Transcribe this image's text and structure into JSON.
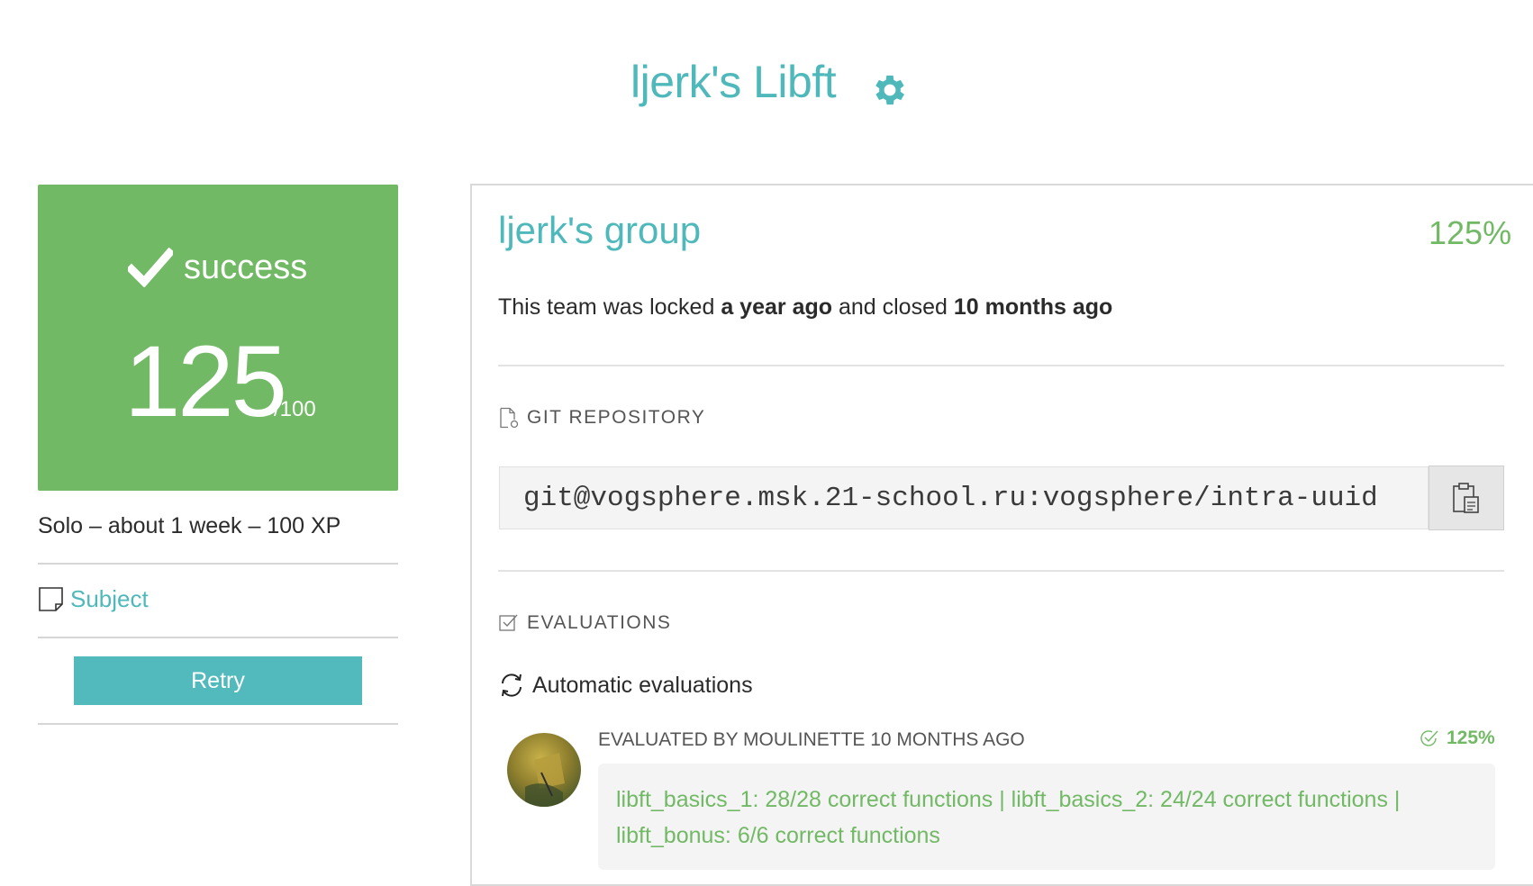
{
  "header": {
    "title": "ljerk's Libft",
    "settings_icon": "gear-icon",
    "accent_color": "#4fb8bb"
  },
  "status_card": {
    "status": "success",
    "status_icon": "checkmark-icon",
    "score": "125",
    "score_max": "/100",
    "color": "#72b965"
  },
  "project_meta": "Solo – about 1 week – 100 XP",
  "subject_link": {
    "label": "Subject",
    "icon": "document-icon"
  },
  "retry_button": "Retry",
  "team": {
    "name": "ljerk's group",
    "final_mark": "125%",
    "locked_prefix": "This team was locked ",
    "locked_time": "a year ago",
    "closed_prefix": " and closed ",
    "closed_time": "10 months ago"
  },
  "git_repository": {
    "heading": "GIT REPOSITORY",
    "icon": "repository-file-icon",
    "url": "git@vogsphere.msk.21-school.ru:vogsphere/intra-uuid",
    "copy_icon": "clipboard-icon"
  },
  "evaluations": {
    "heading": "EVALUATIONS",
    "icon": "checkbox-icon",
    "automatic_label": "Automatic evaluations",
    "automatic_icon": "refresh-icon",
    "items": [
      {
        "evaluator": "EVALUATED BY MOULINETTE 10 MONTHS AGO",
        "score": "125%",
        "score_icon": "check-circle-icon",
        "result": "libft_basics_1: 28/28 correct functions | libft_basics_2: 24/24 correct functions | libft_bonus: 6/6 correct functions"
      }
    ]
  }
}
